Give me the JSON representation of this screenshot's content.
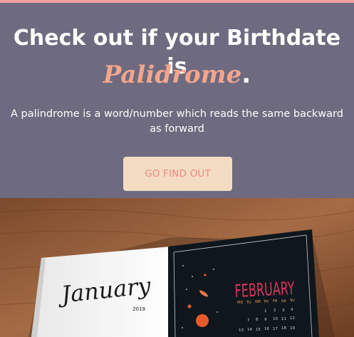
{
  "hero": {
    "title_line1": "Check out if your Birthdate is",
    "accent_word": "Palidrome",
    "accent_punct": ".",
    "description": "A palindrome is a word/number which reads the same backward as forward",
    "cta_label": "GO FIND OUT"
  },
  "image": {
    "left_month": "January",
    "left_year": "2019",
    "right_month": "FEBRUARY",
    "weekdays": [
      "MO",
      "TU",
      "WE",
      "TH",
      "FR",
      "SA",
      "SU"
    ],
    "dates_row1": [
      "1",
      "2",
      "3",
      "4"
    ],
    "dates_row2": [
      "7",
      "8",
      "9",
      "10",
      "11",
      "12"
    ],
    "dates_row3": [
      "13",
      "14",
      "15",
      "16",
      "17",
      "18",
      "19"
    ]
  },
  "colors": {
    "hero_bg": "#6e6a80",
    "accent": "#f4a58a",
    "cta_bg": "#f3dcc2",
    "cta_text": "#f08a7e",
    "top_border": "#f2a0a0"
  }
}
